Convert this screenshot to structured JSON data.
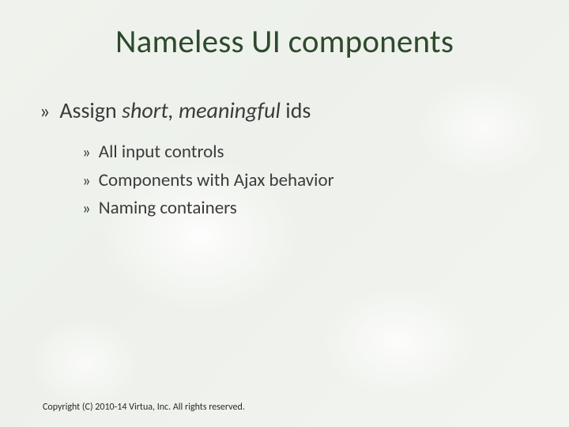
{
  "title": "Nameless UI components",
  "level1": {
    "bullet": "»",
    "text_prefix": "Assign ",
    "text_emph": "short, meaningful",
    "text_suffix": " ids"
  },
  "level2": {
    "bullet": "»",
    "items": [
      "All input controls",
      "Components with Ajax behavior",
      "Naming containers"
    ]
  },
  "footer": "Copyright (C) 2010-14 Virtua, Inc. All rights reserved."
}
